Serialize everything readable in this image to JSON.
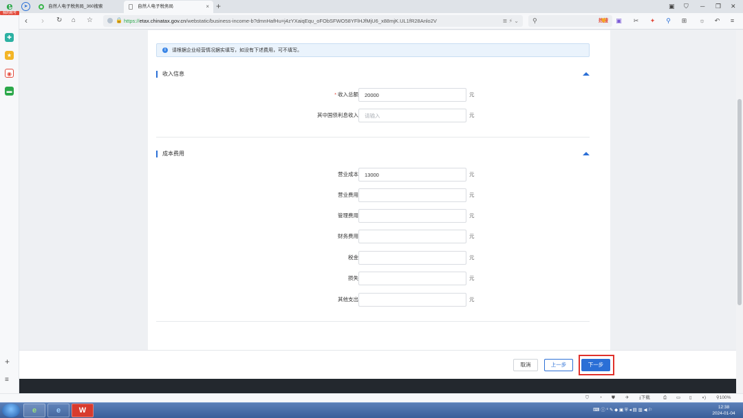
{
  "browser": {
    "logo_badge": "我的账号",
    "tabs": [
      {
        "label": "自然人电子税务局_360搜索"
      },
      {
        "label": "自然人电子税务局"
      }
    ],
    "new_tab": "+",
    "url": {
      "scheme": "https://",
      "domain": "etax.chinatax.gov.cn",
      "path": "/webstatic/business-income-b?dmnHafHu=j4zYXaiqEqu_oFObSFWO58YFlHJfMjU6_x88mjK.UL1fR28Anlo2V"
    },
    "search_hot": "热搜",
    "status_items": [
      "下载",
      "100%"
    ]
  },
  "notice": {
    "text": "请根据企业经营情况据实填写，如没有下述费用，可不填写。"
  },
  "sections": {
    "income": {
      "title": "收入信息",
      "fields": [
        {
          "label": "收入总额",
          "required": "*",
          "value": "20000",
          "placeholder": "",
          "unit": "元"
        },
        {
          "label": "其中国债利息收入",
          "required": "",
          "value": "",
          "placeholder": "请输入",
          "unit": "元"
        }
      ]
    },
    "cost": {
      "title": "成本费用",
      "fields": [
        {
          "label": "营业成本",
          "value": "13000",
          "unit": "元"
        },
        {
          "label": "营业费用",
          "value": "",
          "unit": "元"
        },
        {
          "label": "管理费用",
          "value": "",
          "unit": "元"
        },
        {
          "label": "财务费用",
          "value": "",
          "unit": "元"
        },
        {
          "label": "税金",
          "value": "",
          "unit": "元"
        },
        {
          "label": "损失",
          "value": "",
          "unit": "元"
        },
        {
          "label": "其他支出",
          "value": "",
          "unit": "元"
        }
      ]
    }
  },
  "actions": {
    "cancel": "取消",
    "prev": "上一步",
    "next": "下一步"
  },
  "clock": {
    "time": "12:38",
    "date": "2024-01-04"
  },
  "colors": {
    "accent": "#2a6fd6",
    "highlight": "#e0302a",
    "required": "#e34a3b"
  }
}
